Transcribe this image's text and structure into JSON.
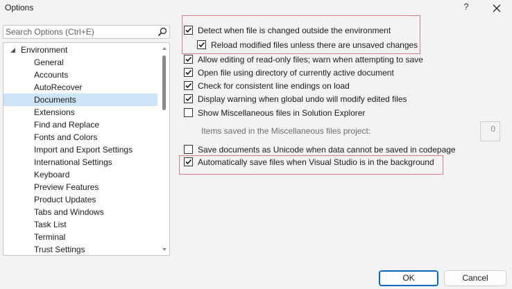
{
  "window": {
    "title": "Options",
    "help": "?",
    "close_icon": "close-icon"
  },
  "search": {
    "placeholder": "Search Options (Ctrl+E)",
    "value": "",
    "icon": "search-icon"
  },
  "tree": {
    "root": {
      "label": "Environment",
      "expanded": true
    },
    "items": [
      {
        "label": "General",
        "selected": false
      },
      {
        "label": "Accounts",
        "selected": false
      },
      {
        "label": "AutoRecover",
        "selected": false
      },
      {
        "label": "Documents",
        "selected": true
      },
      {
        "label": "Extensions",
        "selected": false
      },
      {
        "label": "Find and Replace",
        "selected": false
      },
      {
        "label": "Fonts and Colors",
        "selected": false
      },
      {
        "label": "Import and Export Settings",
        "selected": false
      },
      {
        "label": "International Settings",
        "selected": false
      },
      {
        "label": "Keyboard",
        "selected": false
      },
      {
        "label": "Preview Features",
        "selected": false
      },
      {
        "label": "Product Updates",
        "selected": false
      },
      {
        "label": "Tabs and Windows",
        "selected": false
      },
      {
        "label": "Task List",
        "selected": false
      },
      {
        "label": "Terminal",
        "selected": false
      },
      {
        "label": "Trust Settings",
        "selected": false
      }
    ]
  },
  "options": [
    {
      "label": "Detect when file is changed outside the environment",
      "checked": true
    },
    {
      "label": "Reload modified files unless there are unsaved changes",
      "checked": true
    },
    {
      "label": "Allow editing of read-only files; warn when attempting to save",
      "checked": true
    },
    {
      "label": "Open file using directory of currently active document",
      "checked": true
    },
    {
      "label": "Check for consistent line endings on load",
      "checked": true
    },
    {
      "label": "Display warning when global undo will modify edited files",
      "checked": true
    },
    {
      "label": "Show Miscellaneous files in Solution Explorer",
      "checked": false
    },
    {
      "label": "Save documents as Unicode when data cannot be saved in codepage",
      "checked": false
    },
    {
      "label": "Automatically save files when Visual Studio is in the background",
      "checked": true
    }
  ],
  "misc": {
    "label": "Items saved in the Miscellaneous files project:",
    "value": "0"
  },
  "buttons": {
    "ok": "OK",
    "cancel": "Cancel"
  },
  "colors": {
    "highlight_border": "#e07a86",
    "selection": "#cce4f7",
    "accent": "#0067c0"
  }
}
